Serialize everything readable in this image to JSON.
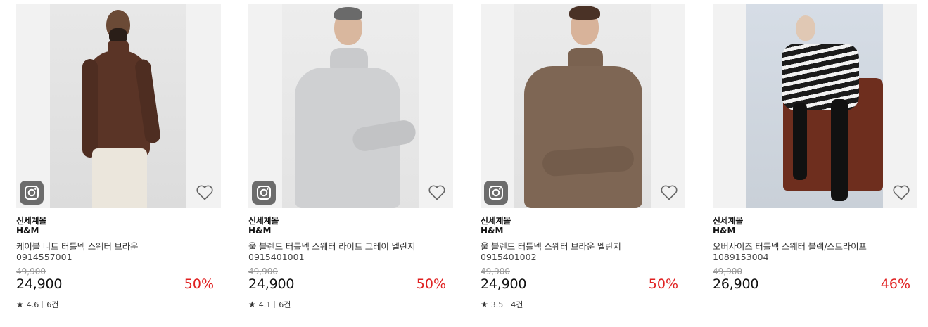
{
  "products": [
    {
      "store": "신세계몰",
      "brand": "H&M",
      "name": "케이블 니트 터틀넥 스웨터 브라운",
      "code": "0914557001",
      "original_price": "49,900",
      "price": "24,900",
      "discount": "50%",
      "rating": "4.6",
      "reviews": "6건",
      "has_instagram_badge": true,
      "sweater_color": "#5a3426"
    },
    {
      "store": "신세계몰",
      "brand": "H&M",
      "name": "울 블렌드 터틀넥 스웨터 라이트 그레이 멜란지",
      "code": "0915401001",
      "original_price": "49,900",
      "price": "24,900",
      "discount": "50%",
      "rating": "4.1",
      "reviews": "6건",
      "has_instagram_badge": true,
      "sweater_color": "#cfd0d2"
    },
    {
      "store": "신세계몰",
      "brand": "H&M",
      "name": "울 블렌드 터틀넥 스웨터 브라운 멜란지",
      "code": "0915401002",
      "original_price": "49,900",
      "price": "24,900",
      "discount": "50%",
      "rating": "3.5",
      "reviews": "4건",
      "has_instagram_badge": true,
      "sweater_color": "#7e6654"
    },
    {
      "store": "신세계몰",
      "brand": "H&M",
      "name": "오버사이즈 터틀넥 스웨터 블랙/스트라이프",
      "code": "1089153004",
      "original_price": "49,900",
      "price": "26,900",
      "discount": "46%",
      "rating": null,
      "reviews": null,
      "has_instagram_badge": false,
      "sweater_color": "#1b1b1b"
    }
  ],
  "colors": {
    "discount": "#e02020",
    "strike": "#999999"
  },
  "icons": {
    "instagram": "instagram-icon",
    "wishlist": "heart-outline-icon",
    "rating": "star-icon"
  }
}
